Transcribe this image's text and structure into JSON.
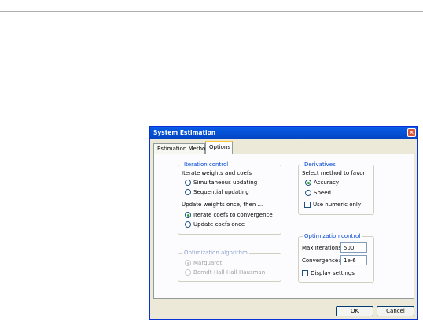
{
  "dialog": {
    "title": "System Estimation",
    "close_glyph": "✕"
  },
  "tabs": [
    {
      "label": "Estimation Method"
    },
    {
      "label": "Options"
    }
  ],
  "iteration": {
    "legend": "Iteration control",
    "group1_label": "Iterate weights and coefs",
    "opt_simultaneous": "Simultaneous updating",
    "opt_sequential": "Sequential updating",
    "group2_label": "Update weights once, then ...",
    "opt_iterate": "Iterate coefs to convergence",
    "opt_once": "Update coefs once"
  },
  "optalgo": {
    "legend": "Optimization algorithm",
    "opt_marquardt": "Marquardt",
    "opt_bhhh": "Berndt-Hall-Hall-Hausman"
  },
  "derivatives": {
    "legend": "Derivatives",
    "label": "Select method to favor",
    "opt_accuracy": "Accuracy",
    "opt_speed": "Speed",
    "numeric_only": "Use numeric only"
  },
  "optcontrol": {
    "legend": "Optimization control",
    "max_iter_label": "Max Iterations:",
    "max_iter_value": "500",
    "convergence_label": "Convergence:",
    "convergence_value": "1e-6",
    "display_settings": "Display settings"
  },
  "buttons": {
    "ok": "OK",
    "cancel": "Cancel"
  }
}
